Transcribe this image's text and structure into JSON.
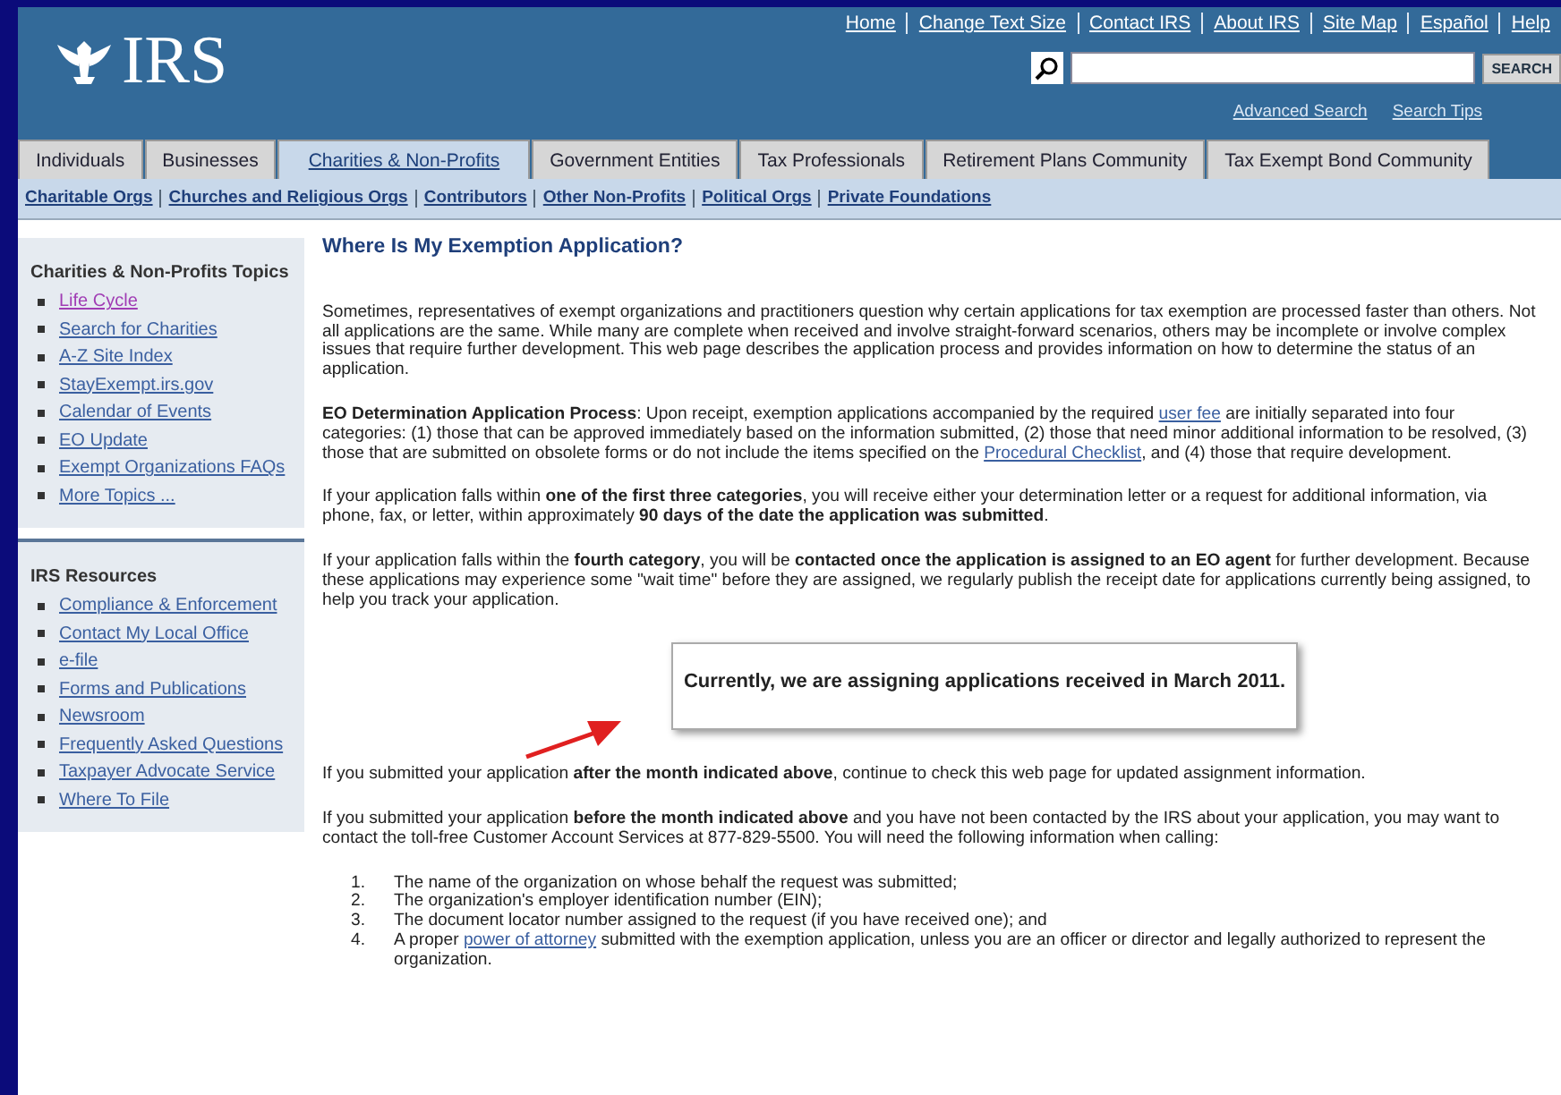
{
  "header": {
    "logo_text": "IRS",
    "top_links": [
      "Home",
      "Change Text Size",
      "Contact IRS",
      "About IRS",
      "Site Map",
      "Español",
      "Help"
    ],
    "search": {
      "button": "SEARCH"
    },
    "search_links": [
      "Advanced Search",
      "Search Tips"
    ]
  },
  "tabs": [
    {
      "label": "Individuals",
      "selected": false
    },
    {
      "label": "Businesses",
      "selected": false
    },
    {
      "label": "Charities & Non-Profits",
      "selected": true
    },
    {
      "label": "Government Entities",
      "selected": false
    },
    {
      "label": "Tax Professionals",
      "selected": false
    },
    {
      "label": "Retirement Plans Community",
      "selected": false
    },
    {
      "label": "Tax Exempt Bond Community",
      "selected": false
    }
  ],
  "subnav": [
    "Charitable Orgs",
    "Churches and Religious Orgs",
    "Contributors",
    "Other Non-Profits",
    "Political Orgs",
    "Private Foundations"
  ],
  "sidebar": {
    "sections": [
      {
        "title": "Charities & Non-Profits Topics",
        "items": [
          {
            "label": "Life Cycle",
            "visited": true
          },
          {
            "label": "Search for Charities",
            "visited": false
          },
          {
            "label": "A-Z Site Index",
            "visited": false
          },
          {
            "label": "StayExempt.irs.gov",
            "visited": false
          },
          {
            "label": "Calendar of Events",
            "visited": false
          },
          {
            "label": "EO Update",
            "visited": false
          },
          {
            "label": "Exempt Organizations FAQs",
            "visited": false
          },
          {
            "label": "More Topics ...",
            "visited": false
          }
        ]
      },
      {
        "title": "IRS Resources",
        "items": [
          {
            "label": "Compliance & Enforcement",
            "visited": false
          },
          {
            "label": "Contact My Local Office",
            "visited": false
          },
          {
            "label": "e-file",
            "visited": false
          },
          {
            "label": "Forms and Publications",
            "visited": false
          },
          {
            "label": "Newsroom",
            "visited": false
          },
          {
            "label": "Frequently Asked Questions",
            "visited": false
          },
          {
            "label": "Taxpayer Advocate Service",
            "visited": false
          },
          {
            "label": "Where To File",
            "visited": false
          }
        ]
      }
    ]
  },
  "main": {
    "title": "Where Is My Exemption Application?",
    "blocks": [
      {
        "kind": "paragraph",
        "segments": [
          {
            "kind": "text",
            "text": "Sometimes, representatives of exempt organizations and practitioners question why certain applications for tax exemption are processed faster than others. Not all applications are the same. While many are complete when received and involve straight-forward scenarios, others may be incomplete or involve complex issues that require further development. This web page describes the application process and provides information on how to determine the status of an application."
          }
        ]
      },
      {
        "kind": "paragraph",
        "segments": [
          {
            "kind": "bold",
            "text": "EO Determination Application Process"
          },
          {
            "kind": "text",
            "text": ": Upon receipt, exemption applications accompanied by the required "
          },
          {
            "kind": "link",
            "text": "user fee"
          },
          {
            "kind": "text",
            "text": " are initially separated into four categories: (1) those that can be approved immediately based on the information submitted, (2) those that need minor additional information to be resolved, (3) those that are submitted on obsolete forms or do not include the items specified on the "
          },
          {
            "kind": "link",
            "text": "Procedural Checklist"
          },
          {
            "kind": "text",
            "text": ", and (4) those that require development."
          }
        ]
      },
      {
        "kind": "paragraph",
        "segments": [
          {
            "kind": "text",
            "text": "If your application falls within "
          },
          {
            "kind": "bold",
            "text": "one of the first three categories"
          },
          {
            "kind": "text",
            "text": ", you will receive either your determination letter or a request for additional information, via phone, fax, or letter, within approximately "
          },
          {
            "kind": "bold",
            "text": "90 days of the date the application was submitted"
          },
          {
            "kind": "text",
            "text": "."
          }
        ]
      },
      {
        "kind": "paragraph",
        "segments": [
          {
            "kind": "text",
            "text": "If your application falls within the "
          },
          {
            "kind": "bold",
            "text": "fourth category"
          },
          {
            "kind": "text",
            "text": ", you will be "
          },
          {
            "kind": "bold",
            "text": "contacted once the application is assigned to an EO agent"
          },
          {
            "kind": "text",
            "text": " for further development. Because these applications may experience some \"wait time\" before they are assigned, we regularly publish the receipt date for applications currently being assigned, to help you track your application."
          }
        ]
      },
      {
        "kind": "callout",
        "text": "Currently, we are assigning applications received in March 2011."
      },
      {
        "kind": "paragraph",
        "segments": [
          {
            "kind": "text",
            "text": "If you submitted your application "
          },
          {
            "kind": "bold",
            "text": "after the month indicated above"
          },
          {
            "kind": "text",
            "text": ", continue to check this web page for updated assignment information."
          }
        ]
      },
      {
        "kind": "paragraph",
        "segments": [
          {
            "kind": "text",
            "text": "If you submitted your application "
          },
          {
            "kind": "bold",
            "text": "before the month indicated above"
          },
          {
            "kind": "text",
            "text": " and you have not been contacted by the IRS about your application, you may want to contact the toll-free Customer Account Services at 877-829-5500. You will need the following information when calling:"
          }
        ]
      },
      {
        "kind": "list",
        "items": [
          {
            "number": "1.",
            "segments": [
              {
                "kind": "text",
                "text": "The name of the organization on whose behalf the request was submitted;"
              }
            ]
          },
          {
            "number": "2.",
            "segments": [
              {
                "kind": "text",
                "text": "The organization's employer identification number (EIN);"
              }
            ]
          },
          {
            "number": "3.",
            "segments": [
              {
                "kind": "text",
                "text": "The document locator number assigned to the request (if you have received one); and"
              }
            ]
          },
          {
            "number": "4.",
            "segments": [
              {
                "kind": "text",
                "text": "A proper "
              },
              {
                "kind": "link",
                "text": "power of attorney"
              },
              {
                "kind": "text",
                "text": " submitted with the exemption application, unless you are an officer or director and legally authorized to represent the organization."
              }
            ]
          }
        ]
      }
    ]
  }
}
